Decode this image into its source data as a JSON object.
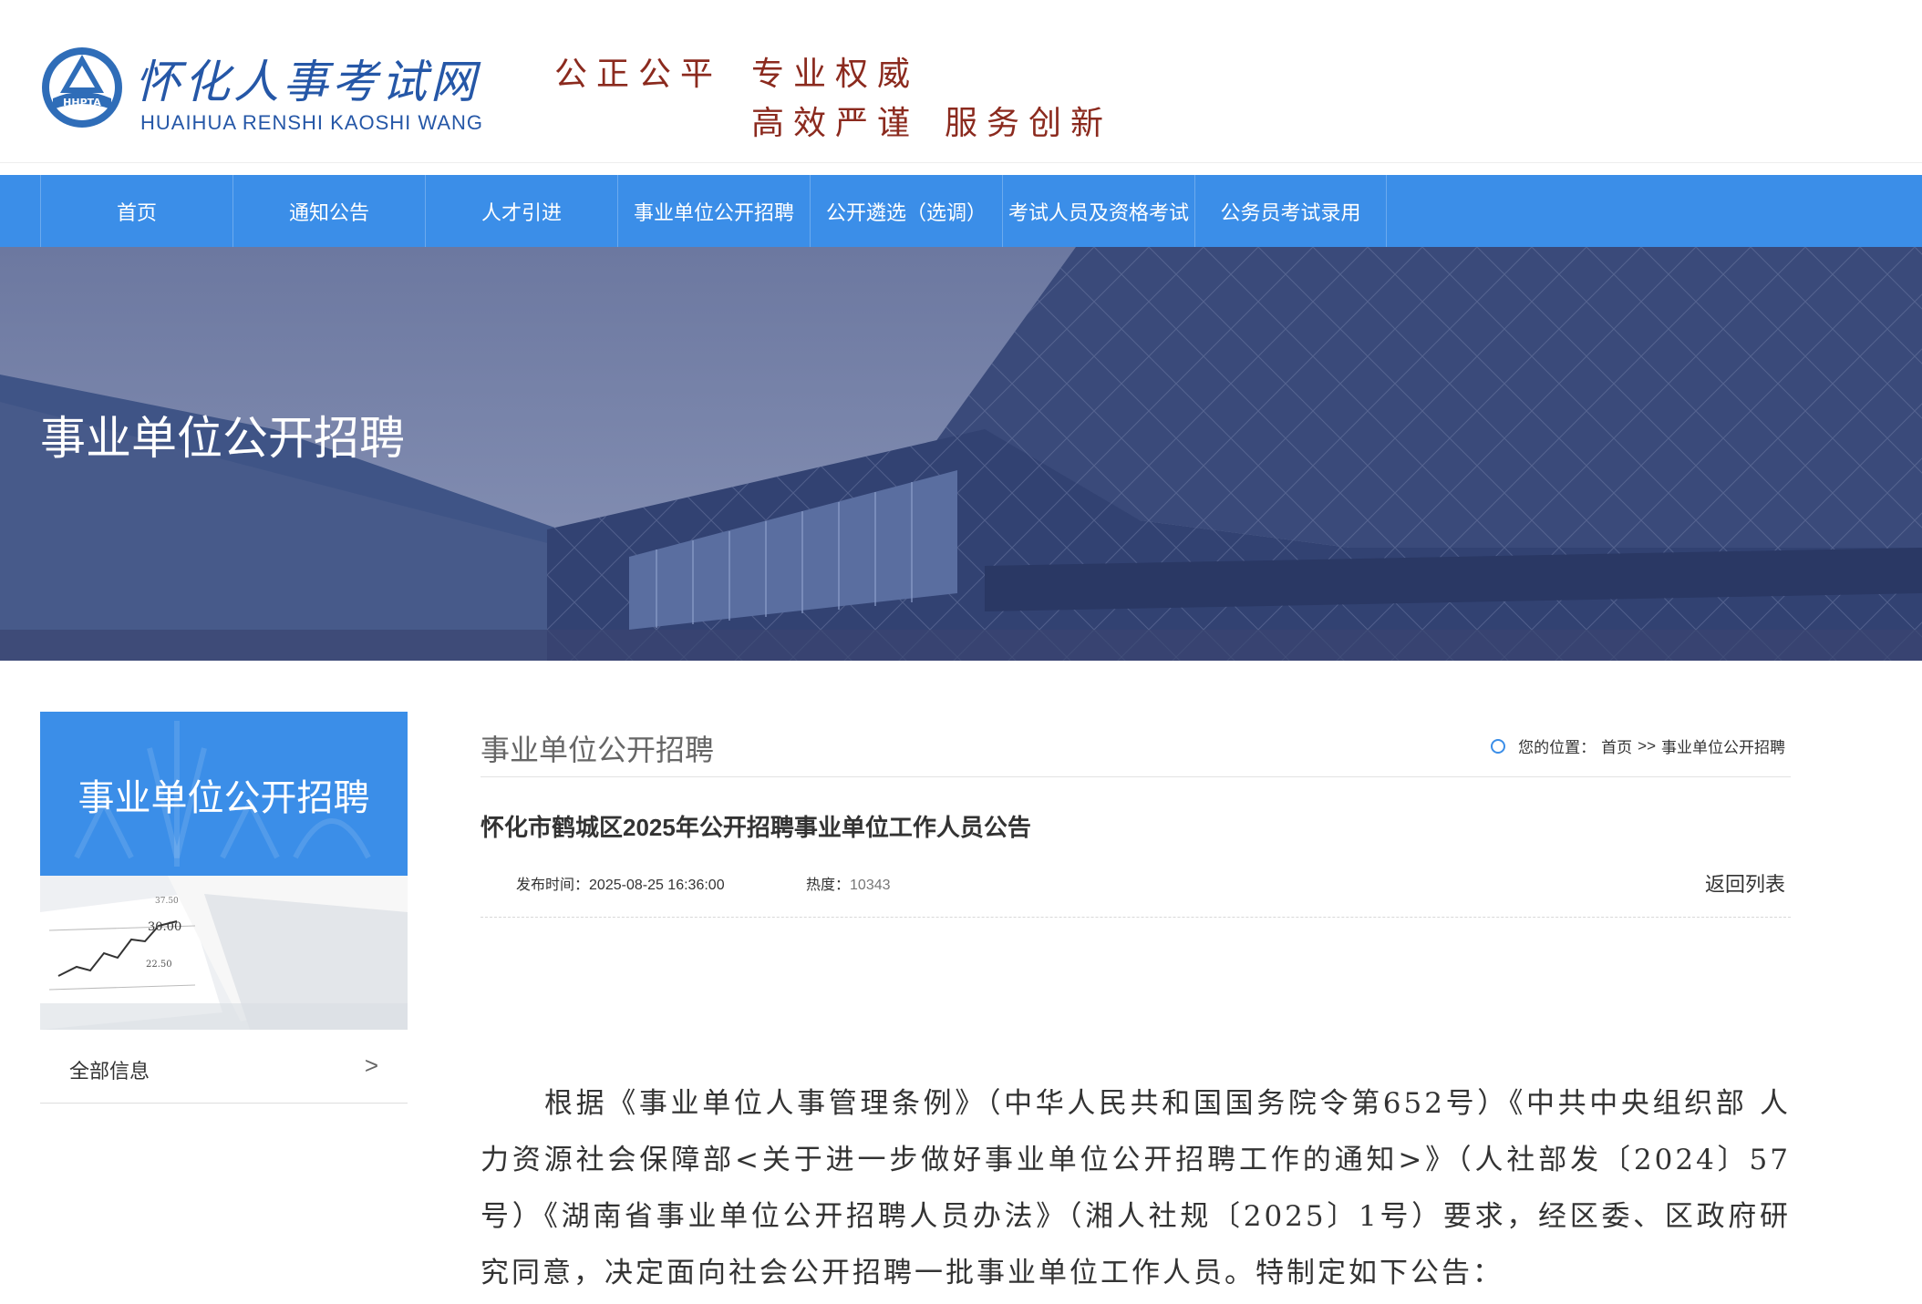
{
  "header": {
    "logo_badge": "HHPTA",
    "site_title": "怀化人事考试网",
    "site_title_pinyin": "HUAIHUA RENSHI KAOSHI WANG",
    "slogans": [
      "公正公平",
      "专业权威",
      "高效严谨",
      "服务创新"
    ]
  },
  "nav": {
    "items": [
      {
        "label": "首页"
      },
      {
        "label": "通知公告"
      },
      {
        "label": "人才引进"
      },
      {
        "label": "事业单位公开招聘"
      },
      {
        "label": "公开遴选（选调）"
      },
      {
        "label": "考试人员及资格考试"
      },
      {
        "label": "公务员考试录用"
      }
    ]
  },
  "banner": {
    "title": "事业单位公开招聘"
  },
  "sidebar": {
    "title": "事业单位公开招聘",
    "chart_numbers": [
      "30.00",
      "22.50",
      "37.50"
    ],
    "items": [
      {
        "label": "全部信息",
        "arrow": ">"
      }
    ]
  },
  "section": {
    "title": "事业单位公开招聘",
    "breadcrumb": {
      "prefix": "您的位置：",
      "home": "首页",
      "sep": ">>",
      "current": "事业单位公开招聘"
    }
  },
  "article": {
    "title": "怀化市鹤城区2025年公开招聘事业单位工作人员公告",
    "publish_label": "发布时间：",
    "publish_time": "2025-08-25 16:36:00",
    "heat_label": "热度：",
    "heat_value": "10343",
    "back_label": "返回列表",
    "paragraph": "根据《事业单位人事管理条例》（中华人民共和国国务院令第652号）《中共中央组织部 人力资源社会保障部<关于进一步做好事业单位公开招聘工作的通知>》（人社部发〔2024〕57号）《湖南省事业单位公开招聘人员办法》（湘人社规〔2025〕1号）要求，经区委、区政府研究同意，决定面向社会公开招聘一批事业单位工作人员。特制定如下公告："
  },
  "colors": {
    "brand_blue": "#3b8ee8",
    "logo_blue": "#2557a7",
    "slogan_red": "#8b2a1e",
    "banner_tint": "#4d5b86"
  }
}
